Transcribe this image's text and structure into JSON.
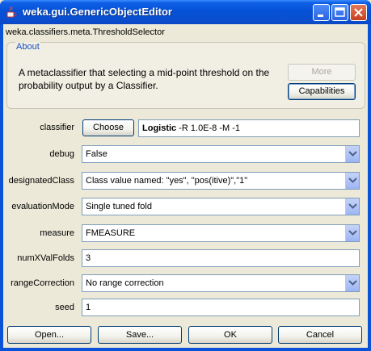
{
  "window": {
    "title": "weka.gui.GenericObjectEditor",
    "class_name": "weka.classifiers.meta.ThresholdSelector"
  },
  "about": {
    "title": "About",
    "description": "A metaclassifier that selecting a mid-point threshold on the probability output by a Classifier.",
    "more_label": "More",
    "capabilities_label": "Capabilities"
  },
  "properties": {
    "classifier": {
      "label": "classifier",
      "choose_label": "Choose",
      "name": "Logistic",
      "options": " -R 1.0E-8 -M -1"
    },
    "debug": {
      "label": "debug",
      "value": "False"
    },
    "designatedClass": {
      "label": "designatedClass",
      "value": "Class value named: \"yes\", \"pos(itive)\",\"1\""
    },
    "evaluationMode": {
      "label": "evaluationMode",
      "value": "Single tuned fold"
    },
    "measure": {
      "label": "measure",
      "value": "FMEASURE"
    },
    "numXValFolds": {
      "label": "numXValFolds",
      "value": "3"
    },
    "rangeCorrection": {
      "label": "rangeCorrection",
      "value": "No range correction"
    },
    "seed": {
      "label": "seed",
      "value": "1"
    }
  },
  "buttons": {
    "open": "Open...",
    "save": "Save...",
    "ok": "OK",
    "cancel": "Cancel"
  },
  "icons": {
    "app": "java-coffee-cup-icon",
    "minimize": "minimize-icon",
    "maximize": "maximize-icon",
    "close": "close-icon",
    "combo": "chevron-down-icon"
  }
}
